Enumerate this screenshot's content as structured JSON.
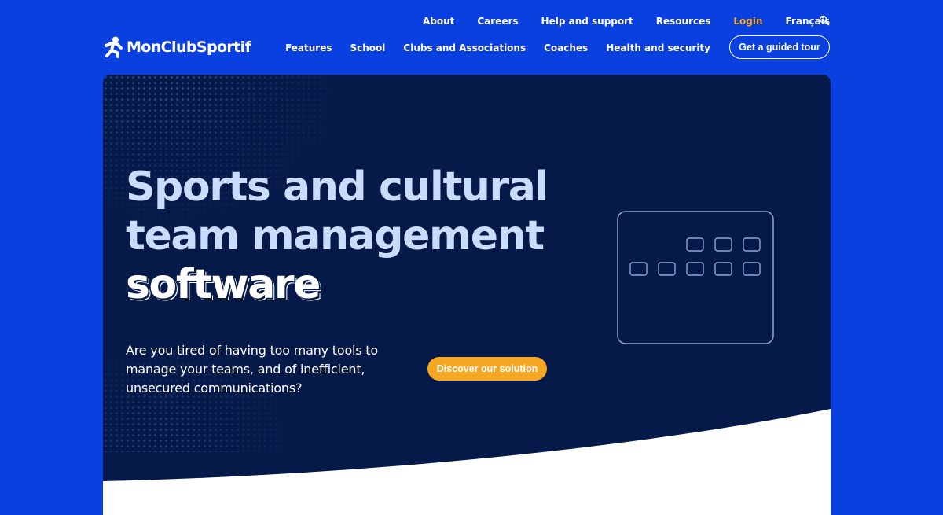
{
  "header": {
    "logo_text": "MonClubSportif",
    "top_links": [
      {
        "label": "About"
      },
      {
        "label": "Careers"
      },
      {
        "label": "Help and support"
      },
      {
        "label": "Resources"
      },
      {
        "label": "Login"
      },
      {
        "label": "Français"
      }
    ],
    "nav": [
      {
        "label": "Features"
      },
      {
        "label": "School"
      },
      {
        "label": "Clubs and Associations"
      },
      {
        "label": "Coaches"
      },
      {
        "label": "Health and security"
      }
    ],
    "cta_label": "Get a guided tour"
  },
  "hero": {
    "title_line1": "Sports and cultural",
    "title_line2": "team management",
    "title_line3": "software",
    "subtitle": "Are you tired of having too many tools to manage your teams, and of inefficient, unsecured communications?",
    "button_label": "Discover our solution"
  },
  "colors": {
    "page_background": "#0a3fe0",
    "hero_background": "#061a4a",
    "accent": "#f5a623",
    "title_color": "#c9dcfb"
  },
  "icons": [
    "runner-logo-icon",
    "search-icon",
    "calendar-icon"
  ]
}
